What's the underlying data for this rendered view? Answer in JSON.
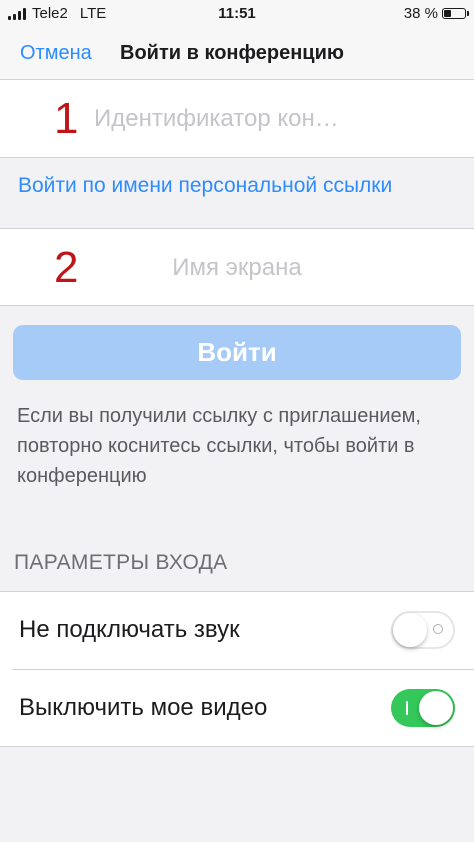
{
  "status_bar": {
    "carrier": "Tele2",
    "network": "LTE",
    "time": "11:51",
    "battery_percent": "38 %",
    "battery_level": 0.38
  },
  "nav": {
    "cancel_label": "Отмена",
    "title": "Войти в конференцию"
  },
  "meeting_id_field": {
    "marker": "1",
    "placeholder": "Идентификатор кон…",
    "value": ""
  },
  "personal_link_label": "Войти по имени персональной ссылки",
  "screen_name_field": {
    "marker": "2",
    "placeholder": "Имя экрана",
    "value": ""
  },
  "join_button_label": "Войти",
  "hint_text": "Если вы получили ссылку с приглашением, повторно коснитесь ссылки, чтобы войти в конференцию",
  "join_options": {
    "header": "ПАРАМЕТРЫ ВХОДА",
    "items": [
      {
        "label": "Не подключать звук",
        "enabled": false
      },
      {
        "label": "Выключить мое видео",
        "enabled": true
      }
    ]
  },
  "colors": {
    "accent": "#2d8cff",
    "join_button_disabled": "#a6cbf6",
    "toggle_on": "#34c759",
    "marker": "#c0141b"
  }
}
